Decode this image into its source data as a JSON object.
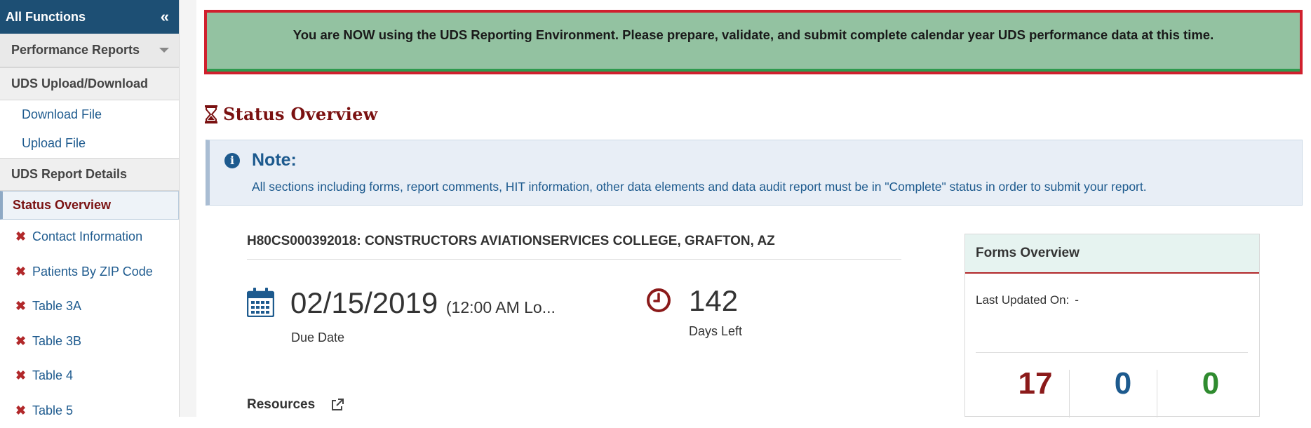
{
  "sidebar": {
    "title": "All Functions",
    "collapse_icon": "double-chevron-left-icon",
    "group_label": "Performance Reports",
    "upload_section": "UDS Upload/Download",
    "download_link": "Download File",
    "upload_link": "Upload File",
    "details_section": "UDS Report Details",
    "active_item": "Status Overview",
    "items": [
      {
        "label": "Contact Information",
        "status": "incomplete"
      },
      {
        "label": "Patients By ZIP Code",
        "status": "incomplete"
      },
      {
        "label": "Table 3A",
        "status": "incomplete"
      },
      {
        "label": "Table 3B",
        "status": "incomplete"
      },
      {
        "label": "Table 4",
        "status": "incomplete"
      },
      {
        "label": "Table 5",
        "status": "incomplete"
      }
    ],
    "incomplete_mark": "✖"
  },
  "banner": {
    "text": "You are NOW using the UDS Reporting Environment. Please prepare, validate, and submit complete calendar year UDS performance data at this time."
  },
  "status": {
    "heading": "Status Overview"
  },
  "note": {
    "title": "Note:",
    "body": "All sections including forms, report comments, HIT information, other data elements and data audit report must be in \"Complete\" status in order to submit your report."
  },
  "grant": {
    "title": "H80CS000392018: CONSTRUCTORS AVIATIONSERVICES COLLEGE, GRAFTON, AZ"
  },
  "due": {
    "date": "02/15/2019",
    "time": "(12:00 AM Lo...",
    "label": "Due Date"
  },
  "days": {
    "value": "142",
    "label": "Days Left"
  },
  "resources": {
    "label": "Resources"
  },
  "forms_overview": {
    "title": "Forms Overview",
    "last_updated_label": "Last Updated On:",
    "last_updated_value": "-",
    "counts": [
      "17",
      "0",
      "0"
    ]
  },
  "colors": {
    "sidebar_header": "#1d4f74",
    "banner_bg": "#93c2a1",
    "banner_border": "#d0202e",
    "heading": "#7a1111",
    "link": "#1d5a8e"
  }
}
